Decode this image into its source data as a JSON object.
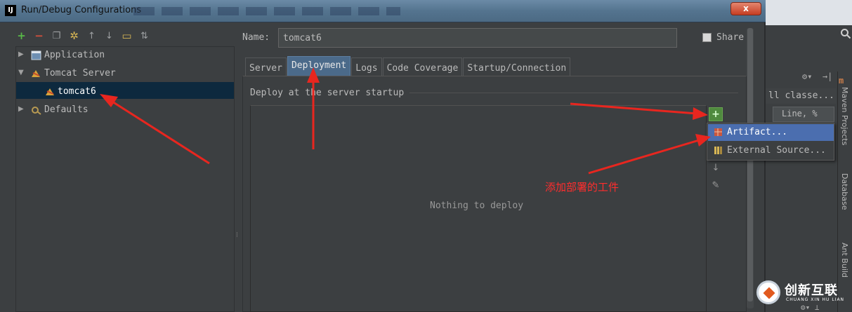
{
  "window": {
    "title": "Run/Debug Configurations",
    "close_label": "x"
  },
  "toolbar": {
    "icons": [
      "add-icon",
      "remove-icon",
      "copy-icon",
      "edit-defaults-icon",
      "move-up-icon",
      "move-down-icon",
      "folder-icon",
      "sort-icon"
    ]
  },
  "tree": {
    "items": [
      {
        "label": "Application",
        "expanded": false
      },
      {
        "label": "Tomcat Server",
        "expanded": true
      },
      {
        "label": "tomcat6",
        "selected": true
      },
      {
        "label": "Defaults",
        "expanded": false
      }
    ]
  },
  "form": {
    "name_label": "Name:",
    "name_value": "tomcat6",
    "share_label": "Share",
    "share_checked": false
  },
  "tabs": [
    {
      "label": "Server"
    },
    {
      "label": "Deployment",
      "active": true
    },
    {
      "label": "Logs"
    },
    {
      "label": "Code Coverage"
    },
    {
      "label": "Startup/Connection"
    }
  ],
  "deployment": {
    "section_title": "Deploy at the server startup",
    "empty_text": "Nothing to deploy"
  },
  "popup": {
    "items": [
      {
        "label": "Artifact...",
        "highlighted": true
      },
      {
        "label": "External Source..."
      }
    ]
  },
  "annotation": {
    "text": "添加部署的工件",
    "color": "#ff2d2d"
  },
  "background_ide": {
    "classes_text": "ll classe...",
    "line_text": "Line, %",
    "vertical_tabs": [
      "Maven Projects",
      "Database",
      "Ant Build"
    ]
  },
  "watermark": {
    "text": "创新互联",
    "sub": "CHUANG XIN HU LIAN"
  },
  "colors": {
    "accent": "#4b6eaf",
    "tab_active": "#4b6a8a",
    "selection": "#0d293e",
    "add_green": "#58b848",
    "remove_red": "#d4503c"
  }
}
